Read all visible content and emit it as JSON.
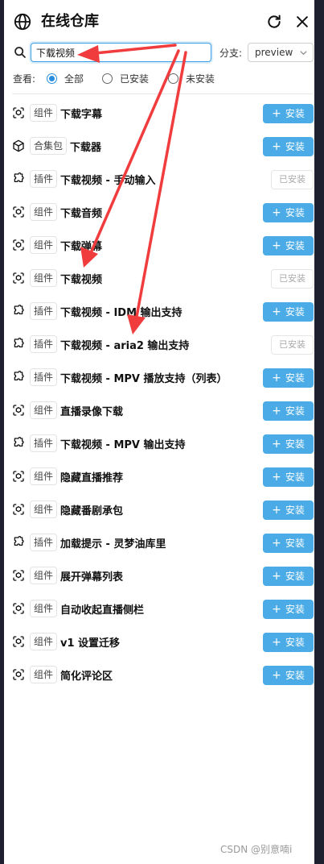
{
  "header": {
    "title": "在线仓库",
    "globe_icon": "globe-icon",
    "refresh_icon": "refresh-icon",
    "close_icon": "close-icon"
  },
  "search": {
    "value": "下载视频",
    "icon": "search-icon"
  },
  "branch": {
    "label": "分支:",
    "selected": "preview"
  },
  "filter": {
    "label": "查看:",
    "options": [
      {
        "label": "全部",
        "checked": true
      },
      {
        "label": "已安装",
        "checked": false
      },
      {
        "label": "未安装",
        "checked": false
      }
    ]
  },
  "labels": {
    "install": "安装",
    "installed": "已安装"
  },
  "items": [
    {
      "type": "组件",
      "icon": "component-icon",
      "name": "下载字幕",
      "installed": false
    },
    {
      "type": "合集包",
      "icon": "package-icon",
      "name": "下载器",
      "installed": false
    },
    {
      "type": "插件",
      "icon": "plugin-icon",
      "name": "下载视频 - 手动输入",
      "installed": true
    },
    {
      "type": "组件",
      "icon": "component-icon",
      "name": "下载音频",
      "installed": false
    },
    {
      "type": "组件",
      "icon": "component-icon",
      "name": "下载弹幕",
      "installed": false
    },
    {
      "type": "组件",
      "icon": "component-icon",
      "name": "下载视频",
      "installed": true
    },
    {
      "type": "插件",
      "icon": "plugin-icon",
      "name": "下载视频 - IDM 输出支持",
      "installed": false
    },
    {
      "type": "插件",
      "icon": "plugin-icon",
      "name": "下载视频 - aria2 输出支持",
      "installed": true
    },
    {
      "type": "插件",
      "icon": "plugin-icon",
      "name": "下载视频 - MPV 播放支持（列表）",
      "installed": false
    },
    {
      "type": "组件",
      "icon": "component-icon",
      "name": "直播录像下载",
      "installed": false
    },
    {
      "type": "插件",
      "icon": "plugin-icon",
      "name": "下载视频 - MPV 输出支持",
      "installed": false
    },
    {
      "type": "组件",
      "icon": "component-icon",
      "name": "隐藏直播推荐",
      "installed": false
    },
    {
      "type": "组件",
      "icon": "component-icon",
      "name": "隐藏番剧承包",
      "installed": false
    },
    {
      "type": "插件",
      "icon": "plugin-icon",
      "name": "加载提示 - 灵梦油库里",
      "installed": false
    },
    {
      "type": "组件",
      "icon": "component-icon",
      "name": "展开弹幕列表",
      "installed": false
    },
    {
      "type": "组件",
      "icon": "component-icon",
      "name": "自动收起直播侧栏",
      "installed": false
    },
    {
      "type": "组件",
      "icon": "component-icon",
      "name": "v1 设置迁移",
      "installed": false
    },
    {
      "type": "组件",
      "icon": "component-icon",
      "name": "简化评论区",
      "installed": false
    }
  ],
  "colors": {
    "accent": "#4aabe6",
    "annotation_arrow": "#f03c3c"
  },
  "watermark": "CSDN @别意喃i"
}
